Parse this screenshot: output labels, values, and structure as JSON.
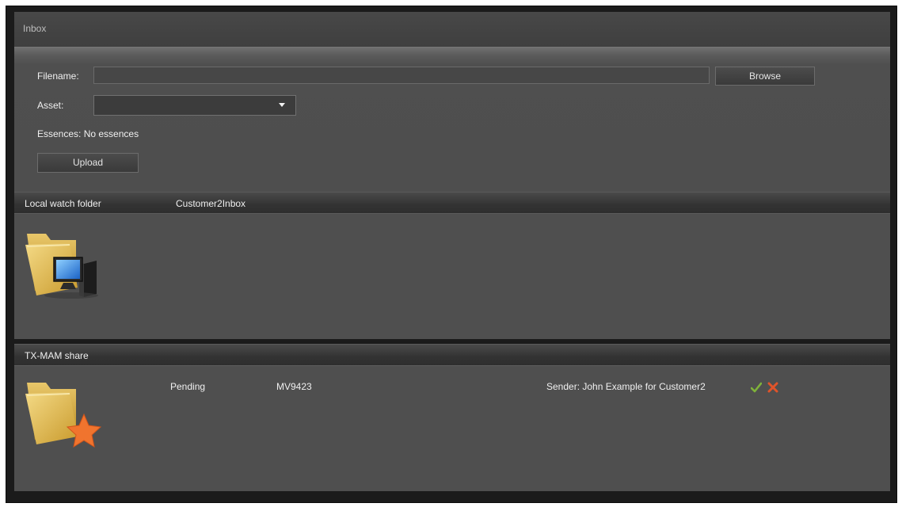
{
  "inbox": {
    "title": "Inbox"
  },
  "upload_form": {
    "filename_label": "Filename:",
    "filename_value": "",
    "browse_label": "Browse",
    "asset_label": "Asset:",
    "asset_selected": "",
    "essences_text": "Essences: No essences",
    "upload_label": "Upload"
  },
  "local_watch": {
    "title": "Local watch folder",
    "folder_name": "Customer2Inbox",
    "icon": "folder-computer-icon"
  },
  "share": {
    "title": "TX-MAM share",
    "icon": "folder-star-icon",
    "items": [
      {
        "status": "Pending",
        "id": "MV9423",
        "sender": "Sender: John Example for Customer2",
        "accept_icon": "check-icon",
        "reject_icon": "x-icon"
      }
    ]
  },
  "colors": {
    "panel_bg": "#4f4f4f",
    "frame_bg": "#1b1b1b",
    "accept": "#7fb23a",
    "reject": "#e0542a"
  }
}
